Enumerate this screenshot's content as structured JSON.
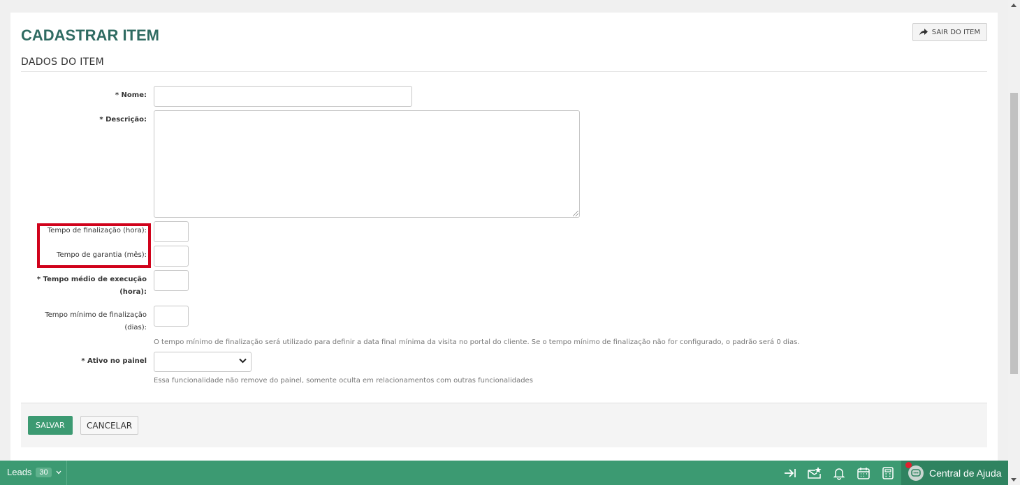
{
  "header": {
    "title": "CADASTRAR ITEM",
    "exit_label": "SAIR DO ITEM"
  },
  "section": {
    "title": "DADOS DO ITEM"
  },
  "form": {
    "nome": {
      "label": "* Nome:",
      "value": ""
    },
    "descricao": {
      "label": "* Descrição:",
      "value": ""
    },
    "tempo_finalizacao": {
      "label": "Tempo de finalização (hora):",
      "value": ""
    },
    "tempo_garantia": {
      "label": "Tempo de garantia (mês):",
      "value": ""
    },
    "tempo_medio": {
      "label_line1": "* Tempo médio de execução",
      "label_line2": "(hora):",
      "value": ""
    },
    "tempo_minimo": {
      "label_line1": "Tempo mínimo de finalização",
      "label_line2": "(dias):",
      "value": "",
      "hint": "O tempo mínimo de finalização será utilizado para definir a data final mínima da visita no portal do cliente. Se o tempo mínimo de finalização não for configurado, o padrão será 0 dias."
    },
    "ativo_painel": {
      "label": "* Ativo no painel",
      "selected": "",
      "hint": "Essa funcionalidade não remove do painel, somente oculta em relacionamentos com outras funcionalidades"
    }
  },
  "actions": {
    "save_label": "SALVAR",
    "cancel_label": "CANCELAR"
  },
  "bottombar": {
    "leads_label": "Leads",
    "leads_count": "30",
    "help_label": "Central de Ajuda",
    "icons": [
      "exit-to-end-icon",
      "mail-star-icon",
      "bell-icon",
      "calendar-icon",
      "calculator-icon",
      "chat-icon"
    ]
  },
  "colors": {
    "title": "#2f6b62",
    "primary": "#3c9a72",
    "highlight": "#d0021b"
  }
}
